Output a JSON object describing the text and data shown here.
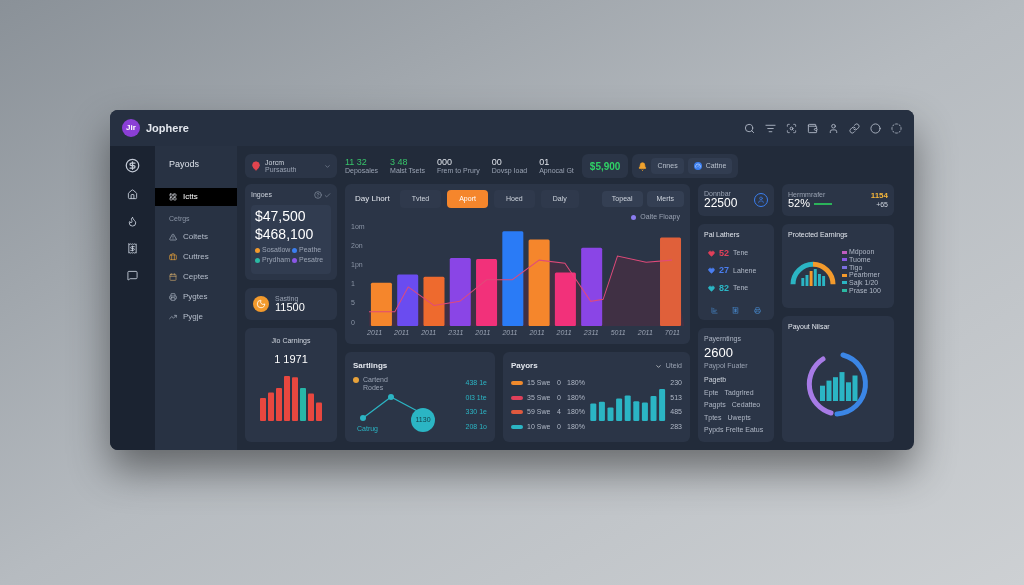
{
  "app": {
    "logo": "Jir",
    "title": "Jophere"
  },
  "nav": {
    "title": "Payods",
    "top_items": [
      {
        "label": "Ictts",
        "selected": true
      }
    ],
    "section_label": "Cetrgs",
    "items": [
      {
        "label": "Coltets",
        "selected": false
      },
      {
        "label": "Cuttres",
        "selected": false
      },
      {
        "label": "Ceptes",
        "selected": false
      },
      {
        "label": "Pygtes",
        "selected": false
      },
      {
        "label": "Pygje",
        "selected": false
      }
    ]
  },
  "stats": {
    "location": {
      "name": "Jorcm",
      "sub": "Pursasuth"
    },
    "metrics": [
      {
        "value": "11 32",
        "label": "Deposales",
        "kind": "positive"
      },
      {
        "value": "3 48",
        "label": "Malst Tsets",
        "kind": "positive"
      },
      {
        "value": "000",
        "label": "Frem to Prury",
        "kind": "neutral"
      },
      {
        "value": "00",
        "label": "Dovsp Ioad",
        "kind": "neutral"
      },
      {
        "value": "01",
        "label": "Apnocal Gt",
        "kind": "neutral"
      }
    ],
    "balance": "$5,900",
    "actions": [
      {
        "label": "Cnnes"
      },
      {
        "label": "Cattne"
      }
    ]
  },
  "ingoes": {
    "title": "Ingoes",
    "amounts": [
      "$47,500",
      "$468,100"
    ],
    "legend": [
      {
        "label": "Sosatlow",
        "color": "#f39a2c"
      },
      {
        "label": "Peathe",
        "color": "#3b7ff0"
      },
      {
        "label": "Prydham",
        "color": "#2bb9a3"
      },
      {
        "label": "Pesatre",
        "color": "#8a57e6"
      }
    ]
  },
  "sasting": {
    "label": "Sasting",
    "value": "11500"
  },
  "jio": {
    "title": "Jio Carnings",
    "value": "1 1971"
  },
  "main_chart": {
    "title": "Day Lhort",
    "tabs": [
      {
        "label": "Tvted",
        "selected": false
      },
      {
        "label": "Aport",
        "selected": true
      },
      {
        "label": "Hoed",
        "selected": false
      },
      {
        "label": "Daly",
        "selected": false
      }
    ],
    "buttons": [
      "Topeal",
      "Merts"
    ],
    "legend": "Oalte Floapy",
    "y_labels": [
      "1om",
      "2on",
      "1pn",
      "1",
      "5",
      "0"
    ],
    "x_labels": [
      "2011",
      "2011",
      "2011",
      "2311",
      "2011",
      "2011",
      "2011",
      "2011",
      "2311",
      "5011",
      "2011",
      "7011"
    ]
  },
  "sartlings": {
    "title": "Sartlings",
    "legend": "Cartend Rodes",
    "point_label": "Catrug",
    "badge": "1130",
    "values": [
      "438 1e",
      "0l3 1te",
      "330 1e",
      "208 1o"
    ]
  },
  "payors": {
    "title": "Payors",
    "filter": "Uteid",
    "rows": [
      {
        "label": "15 Swe",
        "count": "0",
        "percent": "180%",
        "value": "230",
        "color": "#f08a2c"
      },
      {
        "label": "35 Swe",
        "count": "0",
        "percent": "180%",
        "value": "513",
        "color": "#e0405a"
      },
      {
        "label": "59 Swe",
        "count": "4",
        "percent": "180%",
        "value": "485",
        "color": "#e0593e"
      },
      {
        "label": "10 Swe",
        "count": "0",
        "percent": "180%",
        "value": "283",
        "color": "#2bb5c4"
      }
    ]
  },
  "donnbar": {
    "label": "Donnbar",
    "value": "22500"
  },
  "hermm": {
    "label": "Hermmrafer",
    "value": "52%",
    "side_value": "1154",
    "side_sub": "+65"
  },
  "pal": {
    "title": "Pal Lathers",
    "rows": [
      {
        "value": "52",
        "label": "Tene",
        "color": "#e0405a"
      },
      {
        "value": "27",
        "label": "Lahene",
        "color": "#4a7ef0"
      },
      {
        "value": "82",
        "label": "Tene",
        "color": "#2bb5c4"
      }
    ]
  },
  "payerntings": {
    "label": "Payerntings",
    "value": "2600",
    "sub": "Paypol Fuater"
  },
  "pagetb": {
    "title": "Pagetb",
    "items": [
      "Epte",
      "Tadgrlred",
      "Pagpts",
      "Cedatteo",
      "Tptes",
      "Uwepts",
      "Pypds Frelte Eatus"
    ]
  },
  "protected": {
    "title": "Protected Earnings",
    "legend": [
      {
        "label": "Mdpoon",
        "color": "#c05cc0"
      },
      {
        "label": "Tuome",
        "color": "#8a57e6"
      },
      {
        "label": "Tigo",
        "color": "#7b6fe0"
      },
      {
        "label": "Pearbmer",
        "color": "#f39a2c"
      },
      {
        "label": "Sajk 1/20",
        "color": "#2bb5c4"
      },
      {
        "label": "Prase 100",
        "color": "#2bb9a3"
      }
    ]
  },
  "payout": {
    "title": "Payout Nilsar"
  }
}
